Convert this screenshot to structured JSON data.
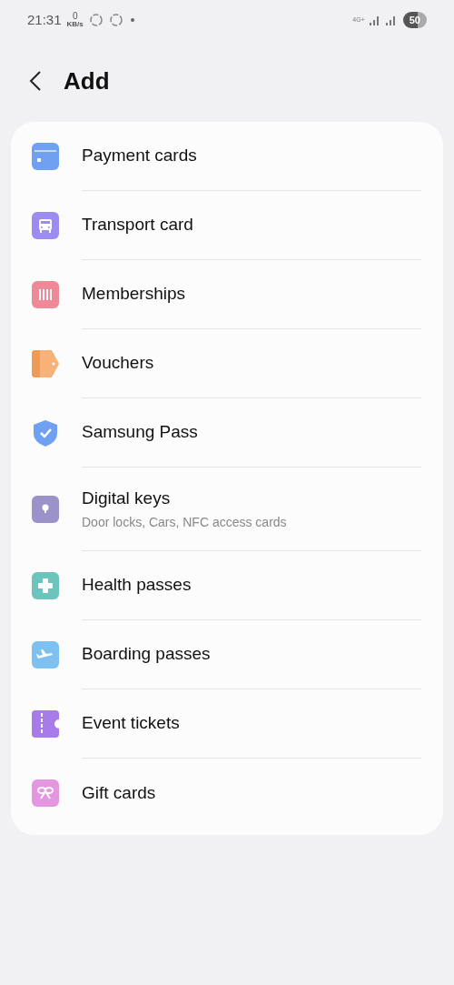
{
  "status_bar": {
    "time": "21:31",
    "speed_value": "0",
    "speed_unit": "KB/s",
    "network": "4G+",
    "battery": "50"
  },
  "header": {
    "title": "Add"
  },
  "items": [
    {
      "kind": "card",
      "label": "Payment cards",
      "color": "#6fa0f2"
    },
    {
      "kind": "bus",
      "label": "Transport card",
      "color": "#9d8cf0"
    },
    {
      "kind": "barcode",
      "label": "Memberships",
      "color": "#ee8a98"
    },
    {
      "kind": "tag",
      "label": "Vouchers",
      "color": "#f7b27a"
    },
    {
      "kind": "shield",
      "label": "Samsung Pass",
      "color": "#6fa0f2"
    },
    {
      "kind": "key",
      "label": "Digital keys",
      "subtitle": "Door locks, Cars, NFC access cards",
      "color": "#9a92c8"
    },
    {
      "kind": "plus",
      "label": "Health passes",
      "color": "#6cc4bc"
    },
    {
      "kind": "plane",
      "label": "Boarding passes",
      "color": "#7ec0ef"
    },
    {
      "kind": "ticket",
      "label": "Event tickets",
      "color": "#a77ce8"
    },
    {
      "kind": "gift",
      "label": "Gift cards",
      "color": "#e596e0"
    }
  ]
}
